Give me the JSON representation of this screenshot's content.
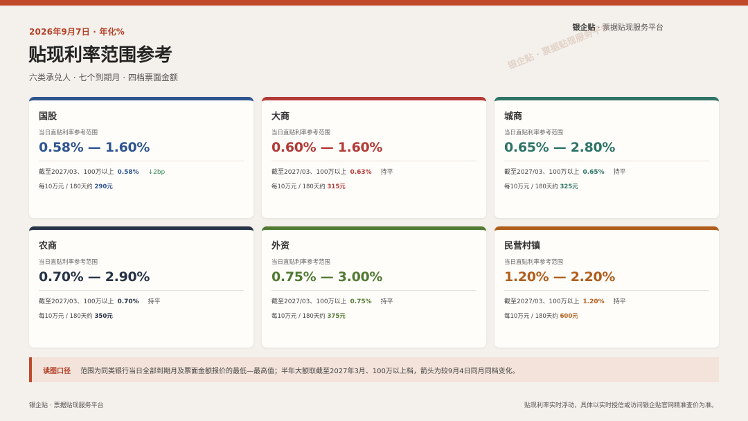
{
  "header": {
    "date_line": "2026年9月7日 · 年化%",
    "title": "贴现利率范围参考",
    "subtitle": "六类承兑人 · 七个到期月 · 四档票面金额",
    "brand_name": "银企贴",
    "brand_tagline": " · 票据贴现服务平台",
    "watermark": "银企贴 · 票据贴现服务平台"
  },
  "common": {
    "range_label": "当日直贴利率参考范围",
    "line1_prefix": "截至2027/03、100万以上",
    "line2_prefix": "每10万元 / 180天约"
  },
  "cards": [
    {
      "name": "国股",
      "range": "0.58% — 1.60%",
      "rate": "0.58%",
      "trend": "↓2bp",
      "amount": "290元",
      "color": "#2f5590"
    },
    {
      "name": "大商",
      "range": "0.60% — 1.60%",
      "rate": "0.63%",
      "trend": "持平",
      "amount": "315元",
      "color": "#b23a36"
    },
    {
      "name": "城商",
      "range": "0.65% — 2.80%",
      "rate": "0.65%",
      "trend": "持平",
      "amount": "325元",
      "color": "#2e7467"
    },
    {
      "name": "农商",
      "range": "0.70% — 2.90%",
      "rate": "0.70%",
      "trend": "持平",
      "amount": "350元",
      "color": "#263446"
    },
    {
      "name": "外资",
      "range": "0.75% — 3.00%",
      "rate": "0.75%",
      "trend": "持平",
      "amount": "375元",
      "color": "#527a33"
    },
    {
      "name": "民营村镇",
      "range": "1.20% — 2.20%",
      "rate": "1.20%",
      "trend": "持平",
      "amount": "600元",
      "color": "#b05e1c"
    }
  ],
  "note": {
    "label": "读图口径",
    "text": "范围为同类银行当日全部到期月及票面金额报价的最低—最高值；半年大额取截至2027年3月、100万以上档，箭头为较9月4日同月同档变化。"
  },
  "footer": {
    "left": "银企贴 · 票据贴现服务平台",
    "right": "贴现利率实时浮动，具体以实时授信或访问银企贴官网精准查价为准。"
  }
}
